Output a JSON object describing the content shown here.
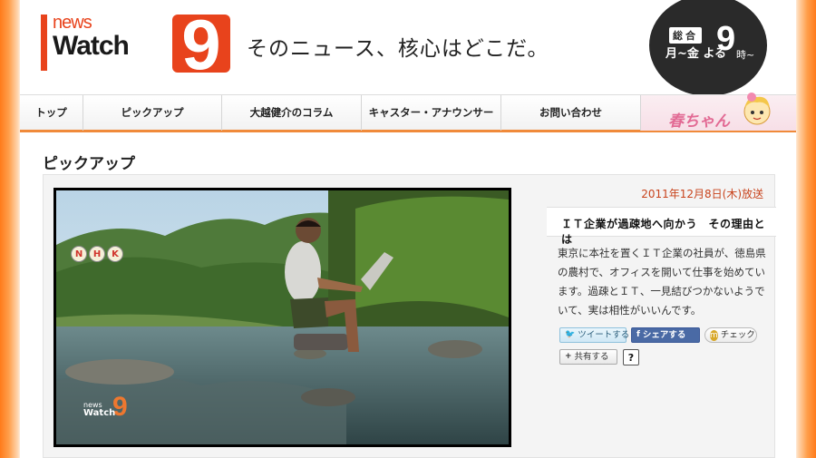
{
  "header": {
    "logo": {
      "news": "news",
      "watch": "Watch",
      "nine": "9"
    },
    "tagline": "そのニュース、核心はどこだ。",
    "schedule": {
      "badge": "総合",
      "days": "月~金 よる",
      "hour": "9",
      "suffix": "時~"
    }
  },
  "nav": {
    "items": [
      {
        "label": "トップ"
      },
      {
        "label": "ピックアップ"
      },
      {
        "label": "大越健介のコラム"
      },
      {
        "label": "キャスター・アナウンサー"
      },
      {
        "label": "お問い合わせ"
      }
    ],
    "haru_label": "春ちゃん"
  },
  "section_title": "ピックアップ",
  "article": {
    "air_date": "2011年12月8日(木)放送",
    "headline": "ＩＴ企業が過疎地へ向かう　その理由とは",
    "description": "東京に本社を置くＩＴ企業の社員が、徳島県の農村で、オフィスを開いて仕事を始めています。過疎とＩＴ、一見結びつかないようでいて、実は相性がいいんです。",
    "video": {
      "nhk": [
        "N",
        "H",
        "K"
      ],
      "watermark": {
        "news": "news",
        "watch": "Watch",
        "nine": "9"
      }
    }
  },
  "share": {
    "tweet": "ツイートする",
    "facebook": "シェアする",
    "mixi": "チェック",
    "share": "共有する",
    "help": "?"
  },
  "colors": {
    "brand_orange": "#e8431c",
    "accent_orange": "#f08a3a",
    "date_red": "#c8431c",
    "facebook_blue": "#3b5998"
  }
}
